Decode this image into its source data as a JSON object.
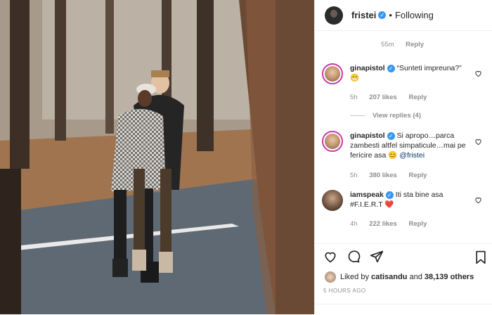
{
  "post": {
    "image_alt": "Couple embracing on a forest road in autumn"
  },
  "header": {
    "username": "fristei",
    "verified": true,
    "separator": "•",
    "follow_state": "Following"
  },
  "top_meta": {
    "time": "55m",
    "reply": "Reply"
  },
  "comments": [
    {
      "username": "ginapistol",
      "verified": true,
      "text": "“Sunteti impreuna?”",
      "emoji": "😁",
      "time": "5h",
      "likes": "207 likes",
      "reply": "Reply",
      "view_replies": "View replies (4)"
    },
    {
      "username": "ginapistol",
      "verified": true,
      "text": "Si apropo…parca zambesti altfel simpaticule…mai pe fericire asa",
      "emoji": "😊",
      "mention": "@fristei",
      "time": "5h",
      "likes": "380 likes",
      "reply": "Reply"
    },
    {
      "username": "iamspeak",
      "verified": true,
      "text": "Iti sta bine asa #F.I.E.R.T",
      "emoji": "❤️",
      "time": "4h",
      "likes": "222 likes",
      "reply": "Reply"
    }
  ],
  "actions": {
    "liked_prefix": "Liked by",
    "liked_user": "catisandu",
    "liked_mid": "and",
    "liked_count": "38,139 others",
    "timestamp": "5 HOURS AGO"
  },
  "icons": [
    "heart-icon",
    "comment-icon",
    "share-icon",
    "bookmark-icon",
    "verified-icon"
  ],
  "colors": {
    "verified": "#3897f0",
    "mention": "#003569",
    "meta": "#8e8e8e",
    "story_ring": "#c837ab"
  }
}
